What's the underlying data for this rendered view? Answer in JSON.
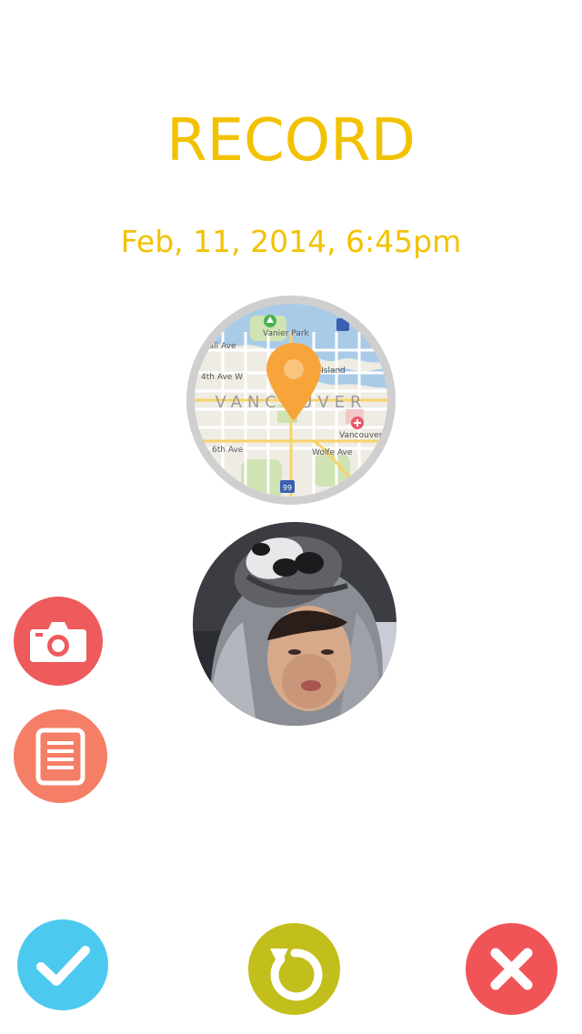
{
  "header": {
    "title": "RECORD",
    "date": "Feb, 11, 2014, 6:45pm"
  },
  "map": {
    "city_label": "VANCOUVER",
    "labels": {
      "park": "Vanier Park",
      "avenue_1": "rnwall Ave",
      "avenue_4": "4th Ave W",
      "avenue_16": "6th Ave",
      "island": "Granville Island",
      "hospital": "Vancouver General Hosp",
      "wolfe": "Wolfe Ave"
    },
    "highway_shield": "99",
    "marker_icon": "location-pin-icon"
  },
  "photo": {
    "icon": "profile-photo"
  },
  "actions": {
    "camera_icon": "camera-icon",
    "notes_icon": "notes-icon"
  },
  "bottom_bar": {
    "confirm_icon": "checkmark-icon",
    "reset_icon": "refresh-icon",
    "cancel_icon": "close-icon"
  },
  "colors": {
    "accent_yellow": "#f2c200",
    "camera_red": "#ef5a5c",
    "notes_coral": "#f47e66",
    "confirm_blue": "#4cc9ee",
    "reset_olive": "#c2be1b",
    "cancel_red": "#f15457",
    "map_pin_orange": "#f7a43a"
  }
}
